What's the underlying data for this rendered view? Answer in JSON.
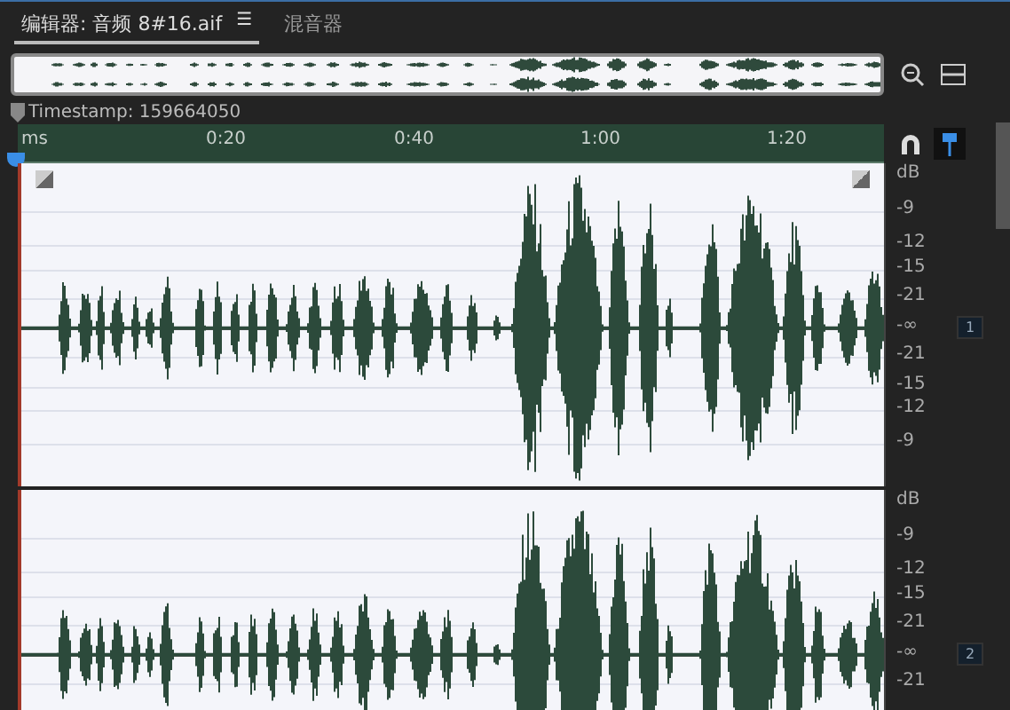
{
  "tabs": [
    {
      "label": "编辑器: 音频 8#16.aif",
      "selected": true,
      "menu_icon": "☰"
    },
    {
      "label": "混音器",
      "selected": false
    }
  ],
  "timestamp": "Timestamp: 159664050",
  "ruler": {
    "labels": [
      "ms",
      "0:20",
      "0:40",
      "1:00",
      "1:20"
    ]
  },
  "tracks": [
    {
      "channel": "1",
      "scale": [
        "dB",
        "-9",
        "-12",
        "-15",
        "-21",
        "-∞",
        "-21",
        "-15",
        "-12",
        "-9"
      ]
    },
    {
      "channel": "2",
      "scale": [
        "dB",
        "-9",
        "-12",
        "-15",
        "-21",
        "-∞",
        "-21"
      ]
    }
  ]
}
